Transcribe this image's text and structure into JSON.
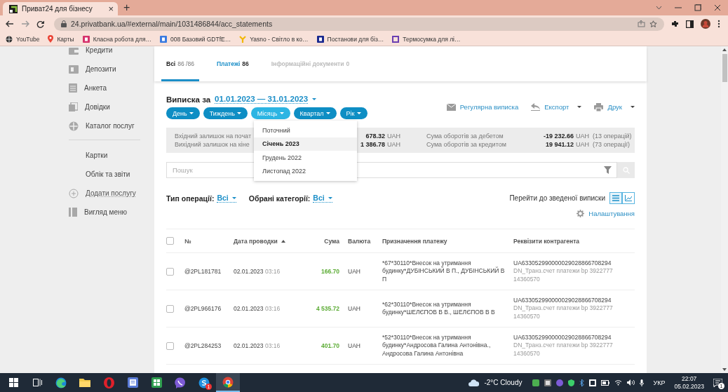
{
  "browser": {
    "tab": {
      "title": "Приват24 для бізнесу",
      "close": "×"
    },
    "new_tab": "+",
    "url": "24.privatbank.ua/#external/main/1031486844/acc_statements",
    "bookmarks": [
      {
        "label": "YouTube",
        "kind": "globe",
        "color": "#333333"
      },
      {
        "label": "Карты",
        "kind": "pin",
        "color": "#ea4335"
      },
      {
        "label": "Класна робота для…",
        "kind": "tile",
        "color": "#d6336c"
      },
      {
        "label": "008 Базовий GDTfE…",
        "kind": "tile",
        "color": "#3b7be0"
      },
      {
        "label": "Yasno - Світло в ко…",
        "kind": "fork",
        "color": "#f2b705"
      },
      {
        "label": "Постанови для біз…",
        "kind": "tile",
        "color": "#1b2a8f"
      },
      {
        "label": "Термосумка для лі…",
        "kind": "outline",
        "color": "#6b3fb2"
      }
    ]
  },
  "sidebar": {
    "services": [
      {
        "label": "Кредити",
        "kind": "credit"
      },
      {
        "label": "Депозити",
        "kind": "deposit"
      },
      {
        "label": "Анкета",
        "kind": "form"
      },
      {
        "label": "Довідки",
        "kind": "docs"
      },
      {
        "label": "Каталог послуг",
        "kind": "catalog"
      }
    ],
    "links": [
      {
        "label": "Картки",
        "kind": "plain"
      },
      {
        "label": "Облік та звіти",
        "kind": "plain"
      },
      {
        "label": "Додати послугу",
        "kind": "add"
      },
      {
        "label": "Вигляд меню",
        "kind": "layout"
      }
    ]
  },
  "statement": {
    "tabs": [
      {
        "label": "Всі",
        "count": "86 /86",
        "selected": true,
        "disabled": false
      },
      {
        "label": "Платежі",
        "count": "86",
        "selected": false,
        "disabled": false
      },
      {
        "label": "Інформаційні документи",
        "count": "0",
        "selected": false,
        "disabled": true
      }
    ],
    "title": "Виписка за",
    "period": "01.01.2023 — 31.01.2023",
    "period_buttons": [
      {
        "label": "День",
        "expanded": false
      },
      {
        "label": "Тиждень",
        "expanded": false
      },
      {
        "label": "Місяць",
        "expanded": true
      },
      {
        "label": "Квартал",
        "expanded": false
      },
      {
        "label": "Рік",
        "expanded": false
      }
    ],
    "period_menu": [
      {
        "label": "Поточний",
        "selected": false
      },
      {
        "label": "Січень 2023",
        "selected": true
      },
      {
        "label": "Грудень 2022",
        "selected": false
      },
      {
        "label": "Листопад 2022",
        "selected": false
      }
    ],
    "actions": [
      {
        "label": "Регулярна виписка",
        "kind": "mail",
        "has_menu": false
      },
      {
        "label": "Експорт",
        "kind": "export",
        "has_menu": true
      },
      {
        "label": "Друк",
        "kind": "print",
        "has_menu": true
      }
    ],
    "summary": {
      "balances": [
        {
          "label": "Вхідний залишок на почат",
          "amount": "678.32",
          "currency": "UAH"
        },
        {
          "label": "Вихідний залишок на кіне",
          "amount": "1 386.78",
          "currency": "UAH"
        }
      ],
      "turnovers": [
        {
          "label": "Сума оборотів за дебетом",
          "amount": "-19 232.66",
          "currency": "UAH",
          "count": "(13 операцій)"
        },
        {
          "label": "Сума оборотів за кредитом",
          "amount": "19 941.12",
          "currency": "UAH",
          "count": "(73 операції)"
        }
      ]
    },
    "search": {
      "placeholder": "Пошук"
    },
    "filters": [
      {
        "label": "Тип операції:",
        "value": "Всі"
      },
      {
        "label": "Обрані категорії:",
        "value": "Всі"
      }
    ],
    "summary_link": "Перейти до зведеної виписки",
    "view_buttons": [
      {
        "kind": "list",
        "selected": true
      },
      {
        "kind": "chart",
        "selected": false
      }
    ],
    "settings": "Налаштування",
    "table": {
      "all_checked": false,
      "columns": [
        {
          "label": "№",
          "kind": "text",
          "sorted": false
        },
        {
          "label": "Дата проводки",
          "kind": "text",
          "sorted": true
        },
        {
          "label": "Сума",
          "kind": "number",
          "sorted": false
        },
        {
          "label": "Валюта",
          "kind": "text",
          "sorted": false
        },
        {
          "label": "Призначення платежу",
          "kind": "text",
          "sorted": false
        },
        {
          "label": "Реквізити контрагента",
          "kind": "text",
          "sorted": false
        }
      ],
      "rows": [
        {
          "checked": false,
          "number": "@2PL181781",
          "date": "02.01.2023",
          "time": "03:16",
          "amount": "166.70",
          "incoming": true,
          "currency": "UAH",
          "purpose": "*67*30110*Внесок на утримання будинку*ДУБІНСЬКИЙ В П., ДУБІНСЬКИЙ В П",
          "account": "UA633052990000029028866708294",
          "counterparty": "DN_Транз.счет платежи bp 3922777 14360570"
        },
        {
          "checked": false,
          "number": "@2PL966176",
          "date": "02.01.2023",
          "time": "03:16",
          "amount": "4 535.72",
          "incoming": true,
          "currency": "UAH",
          "purpose": "*62*30110*Внесок на утримання будинку*ШЕЛЄПОВ В В., ШЕЛЄПОВ В В",
          "account": "UA633052990000029028866708294",
          "counterparty": "DN_Транз.счет платежи bp 3922777 14360570"
        },
        {
          "checked": false,
          "number": "@2PL284253",
          "date": "02.01.2023",
          "time": "03:16",
          "amount": "401.70",
          "incoming": true,
          "currency": "UAH",
          "purpose": "*52*30110*Внесок на утримання будинку*Андросова Галина Антонівна., Андросова Галина Антонівна",
          "account": "UA633052990000029028866708294",
          "counterparty": "DN_Транз.счет платежи bp 3922777 14360570"
        }
      ]
    }
  },
  "taskbar": {
    "apps": [
      {
        "kind": "start",
        "active": false
      },
      {
        "kind": "taskview",
        "active": false
      },
      {
        "kind": "edge",
        "active": false
      },
      {
        "kind": "folder",
        "active": false
      },
      {
        "kind": "opera",
        "active": false
      },
      {
        "kind": "notes",
        "active": false
      },
      {
        "kind": "sheet",
        "active": false
      },
      {
        "kind": "viber",
        "active": false
      },
      {
        "kind": "skype",
        "active": false,
        "badge": "1"
      },
      {
        "kind": "chrome",
        "active": true
      }
    ],
    "weather": "-2°C Cloudy",
    "language": "УКР",
    "time": "22:07",
    "date": "05.02.2023",
    "notifications": "1"
  }
}
